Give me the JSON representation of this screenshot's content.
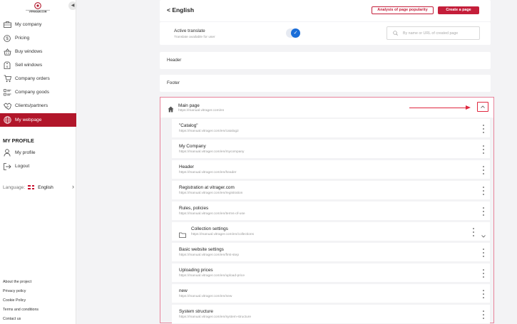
{
  "sidebar": {
    "logo_text": "VITRAGER.COM",
    "collapse_icon": "chevron-left-icon",
    "nav": [
      {
        "label": "My company",
        "icon": "company-icon"
      },
      {
        "label": "Pricing",
        "icon": "dollar-icon"
      },
      {
        "label": "Buy windows",
        "icon": "basket-icon"
      },
      {
        "label": "Sell windows",
        "icon": "tag-icon"
      },
      {
        "label": "Company orders",
        "icon": "cart-icon"
      },
      {
        "label": "Company goods",
        "icon": "list-icon"
      },
      {
        "label": "Clients/partners",
        "icon": "handshake-icon"
      },
      {
        "label": "My webpage",
        "icon": "globe-icon",
        "active": true
      }
    ],
    "profile_title": "MY PROFILE",
    "profile_nav": [
      {
        "label": "My profile",
        "icon": "user-icon"
      },
      {
        "label": "Logout",
        "icon": "logout-icon"
      }
    ],
    "language_label": "Language:",
    "language_value": "English",
    "footer_links": [
      "About the project",
      "Privacy policy",
      "Cookie Policy",
      "Terms and conditions",
      "Contact us"
    ]
  },
  "topbar": {
    "back_label": "< English",
    "analysis_button": "Analysis of page popularity",
    "create_button": "Create a page"
  },
  "translate": {
    "label": "Active translate",
    "sublabel": "Translate available for user",
    "enabled": true,
    "search_placeholder": "By name or URL of created page"
  },
  "sections": {
    "header": "Header",
    "footer": "Footer"
  },
  "main_page": {
    "title": "Main page",
    "url": "https://manual.vitrager.com/en"
  },
  "pages": [
    {
      "title": "\"Catalog\"",
      "url": "https://manual.vitrager.com/en/catalog2"
    },
    {
      "title": "My Company",
      "url": "https://manual.vitrager.com/en/mycompany"
    },
    {
      "title": "Header",
      "url": "https://manual.vitrager.com/en/header"
    },
    {
      "title": "Registration at vitrager.com",
      "url": "https://manual.vitrager.com/en/registration"
    },
    {
      "title": "Rules, policies",
      "url": "https://manual.vitrager.com/en/terms-of-use"
    },
    {
      "title": "Collection settings",
      "url": "https://manual.vitrager.com/en/collections",
      "folder": true
    },
    {
      "title": "Basic website settings",
      "url": "https://manual.vitrager.com/en/first-step"
    },
    {
      "title": "Uploading prices",
      "url": "https://manual.vitrager.com/en/upload-price"
    },
    {
      "title": "new",
      "url": "https://manual.vitrager.com/en/new"
    },
    {
      "title": "System structure",
      "url": "https://manual.vitrager.com/en/system-structure"
    }
  ],
  "colors": {
    "accent": "#b1162a",
    "toggle": "#1a6dd8",
    "highlight": "#e0283f"
  }
}
